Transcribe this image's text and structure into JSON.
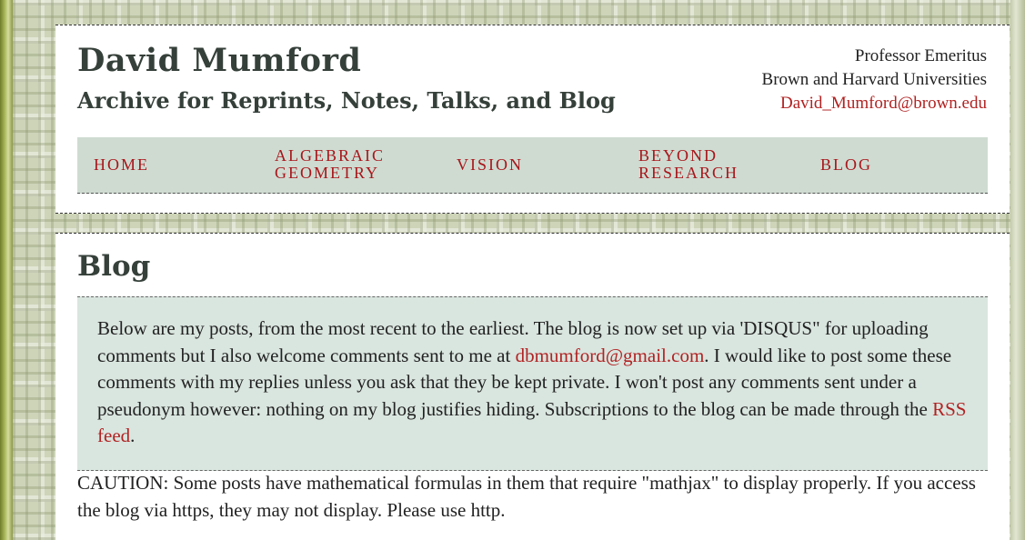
{
  "header": {
    "title": "David Mumford",
    "subtitle": "Archive for Reprints, Notes, Talks, and Blog",
    "affiliation_line1": "Professor Emeritus",
    "affiliation_line2": "Brown and Harvard Universities",
    "email": "David_Mumford@brown.edu"
  },
  "nav": {
    "items": [
      {
        "line1": "HOME",
        "line2": ""
      },
      {
        "line1": "ALGEBRAIC",
        "line2": "GEOMETRY"
      },
      {
        "line1": "VISION",
        "line2": ""
      },
      {
        "line1": "BEYOND",
        "line2": "RESEARCH"
      },
      {
        "line1": "BLOG",
        "line2": ""
      }
    ]
  },
  "main": {
    "heading": "Blog",
    "intro": {
      "text_1": "Below are my posts, from the most recent to the earliest. The blog is now set up via 'DISQUS\" for uploading comments but I also welcome comments sent to me at ",
      "email_link": "dbmumford@gmail.com",
      "text_2": ". I would like to post some these comments with my replies unless you ask that they be kept private. I won't post any comments sent under a pseudonym however: nothing on my blog justifies hiding. Subscriptions to the blog can be made through the ",
      "rss_link": "RSS feed",
      "text_3": "."
    },
    "caution": "CAUTION: Some posts have mathematical formulas in them that require \"mathjax\" to display properly. If you access the blog via https, they may not display. Please use http."
  },
  "colors": {
    "link": "#b22222",
    "nav_text": "#a8161b",
    "nav_bg": "#cfdbd1",
    "intro_bg": "#d9e5df",
    "heading": "#36403a"
  }
}
